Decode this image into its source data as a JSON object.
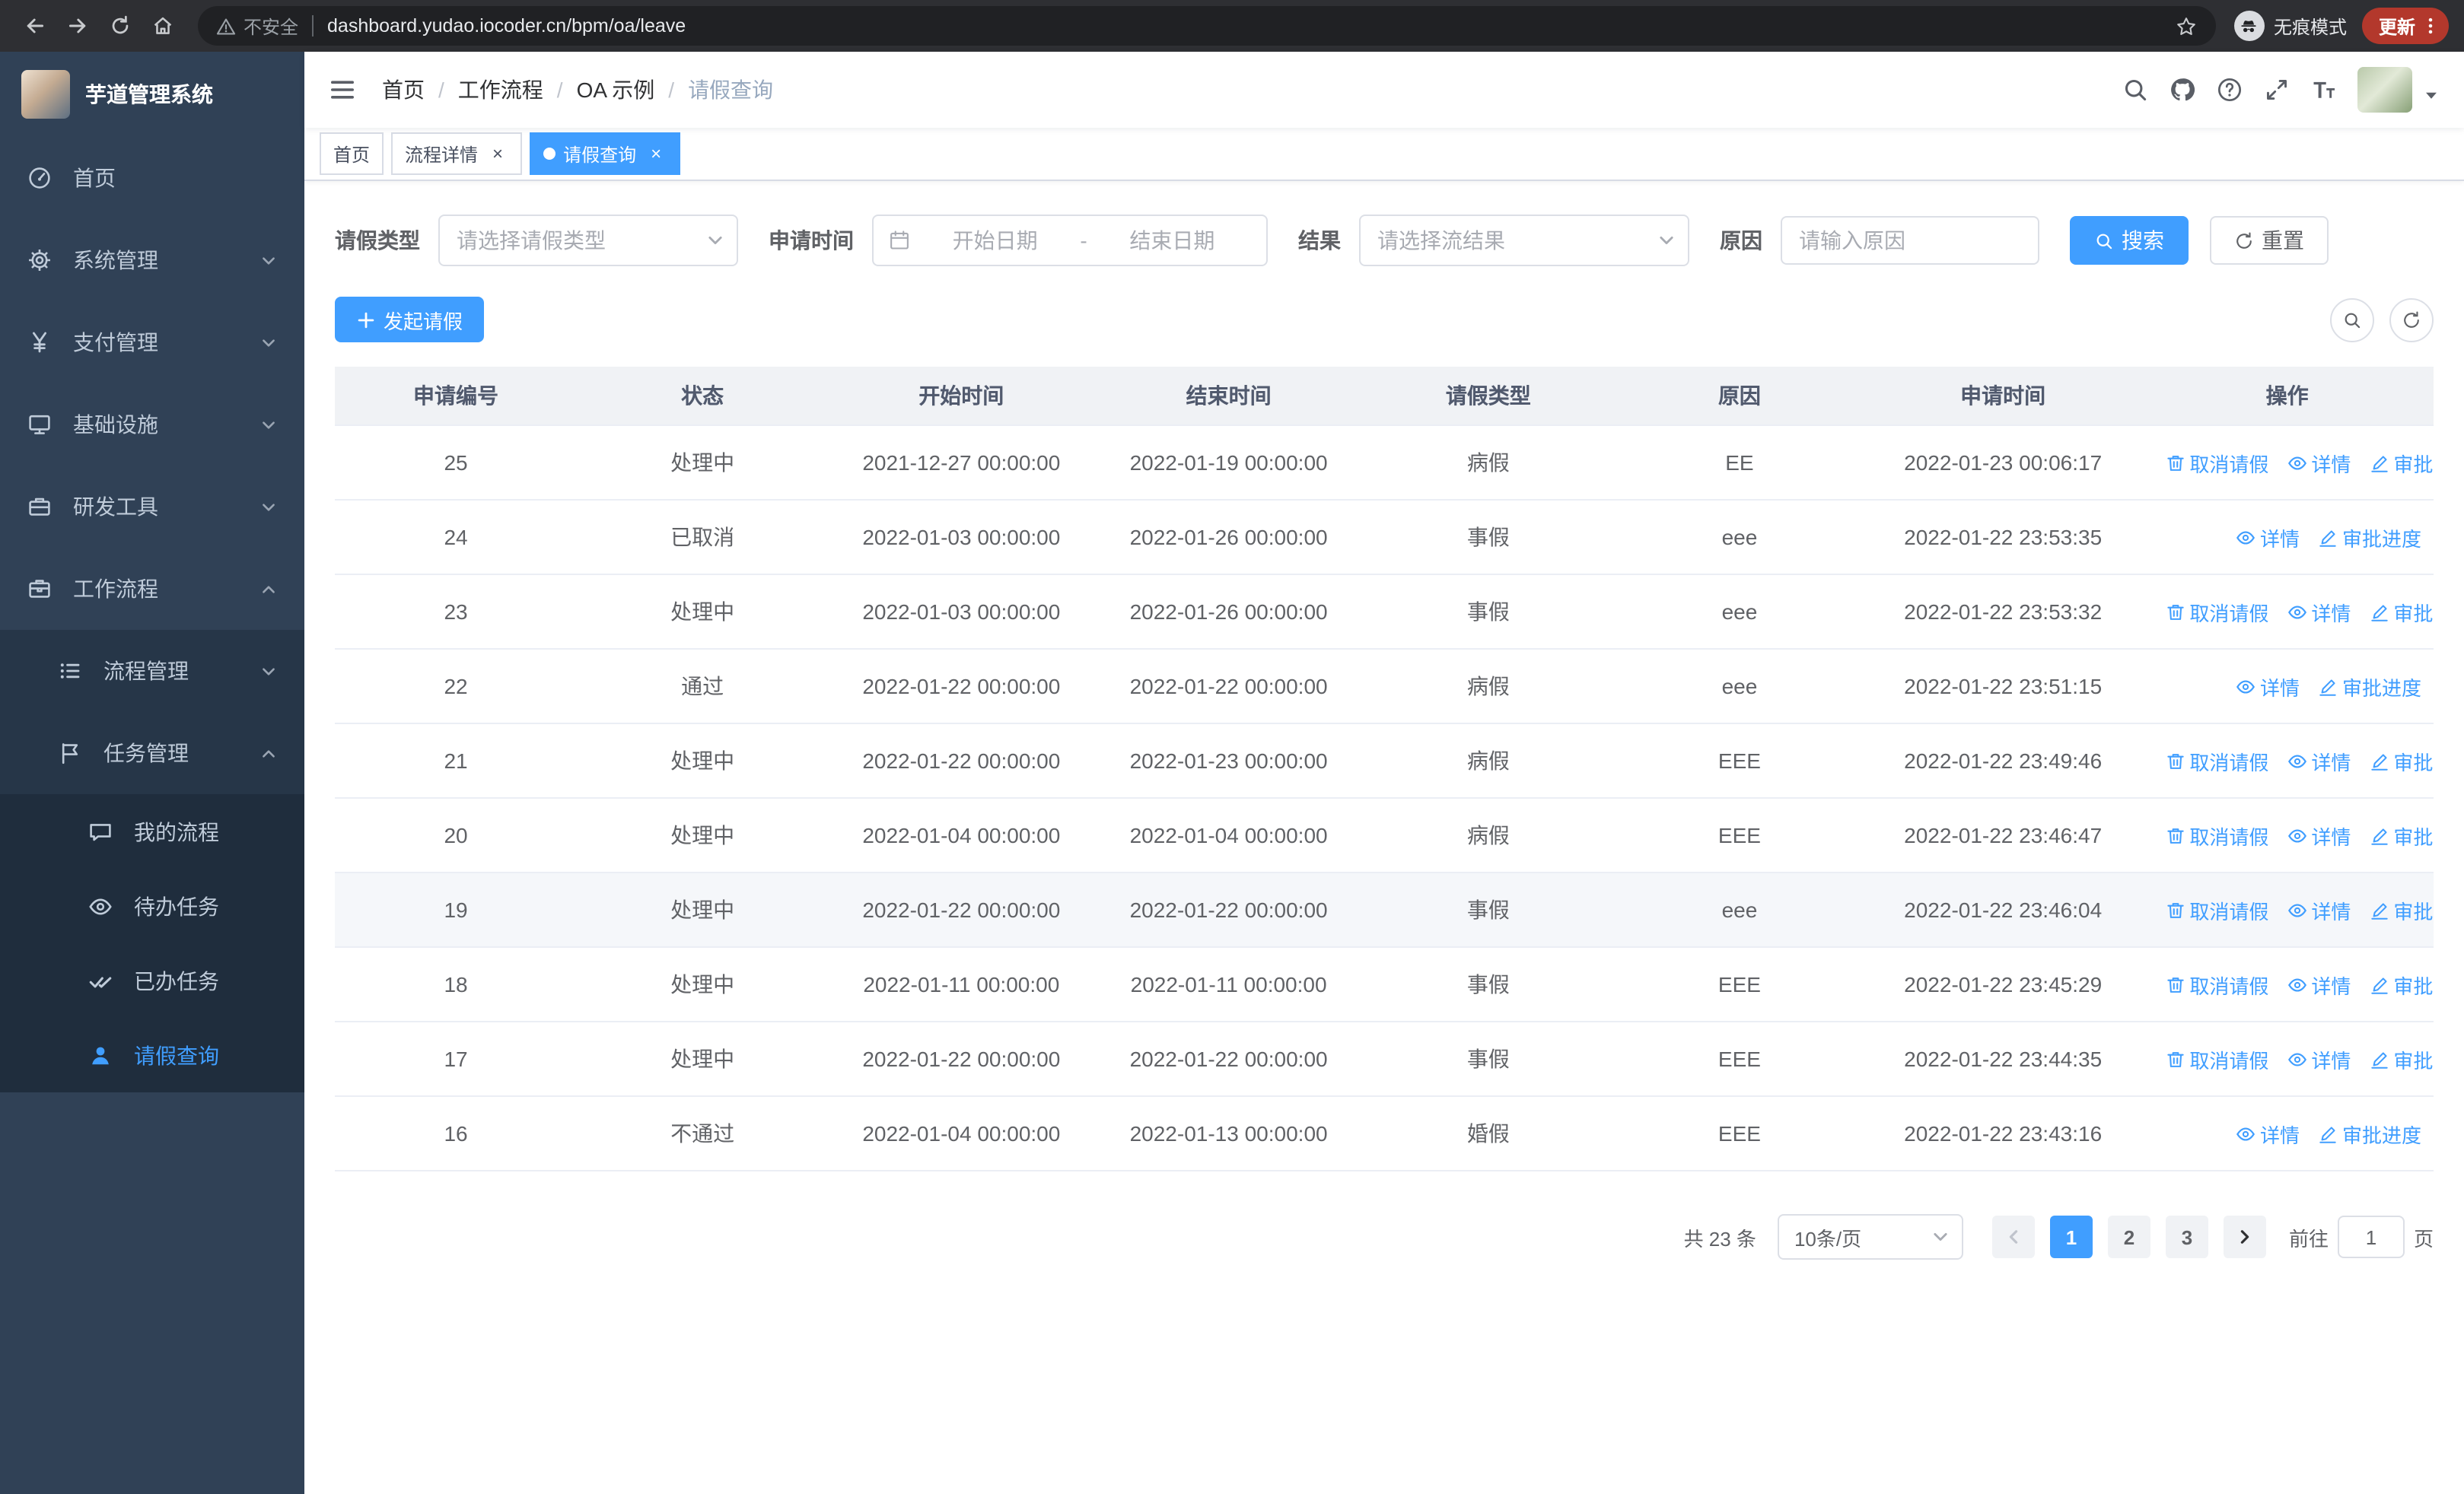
{
  "colors": {
    "accent": "#409eff"
  },
  "browser": {
    "security_chip": "不安全",
    "url": "dashboard.yudao.iocoder.cn/bpm/oa/leave",
    "incognito_label": "无痕模式",
    "update_button": "更新"
  },
  "sidebar": {
    "logo_title": "芋道管理系统",
    "menu": [
      {
        "id": "home",
        "label": "首页",
        "icon": "dashboard",
        "level": 1
      },
      {
        "id": "system",
        "label": "系统管理",
        "icon": "gear",
        "level": 1,
        "chevron": "down"
      },
      {
        "id": "payment",
        "label": "支付管理",
        "icon": "yen",
        "level": 1,
        "chevron": "down"
      },
      {
        "id": "infrastructure",
        "label": "基础设施",
        "icon": "monitor",
        "level": 1,
        "chevron": "down"
      },
      {
        "id": "dev-tools",
        "label": "研发工具",
        "icon": "toolbox",
        "level": 1,
        "chevron": "down"
      },
      {
        "id": "workflow",
        "label": "工作流程",
        "icon": "briefcase",
        "level": 1,
        "chevron": "up"
      },
      {
        "id": "process-management",
        "label": "流程管理",
        "icon": "list",
        "level": 2,
        "chevron": "down"
      },
      {
        "id": "task-management",
        "label": "任务管理",
        "icon": "flag",
        "level": 2,
        "chevron": "up"
      },
      {
        "id": "my-process",
        "label": "我的流程",
        "icon": "chat",
        "level": 3
      },
      {
        "id": "todo-tasks",
        "label": "待办任务",
        "icon": "eye",
        "level": 3
      },
      {
        "id": "done-tasks",
        "label": "已办任务",
        "icon": "dblcheck",
        "level": 3
      },
      {
        "id": "leave-query",
        "label": "请假查询",
        "icon": "user",
        "level": 3,
        "active": true
      }
    ]
  },
  "navbar": {
    "breadcrumb": [
      "首页",
      "工作流程",
      "OA 示例",
      "请假查询"
    ]
  },
  "tabs": [
    {
      "id": "home",
      "label": "首页",
      "active": false,
      "closable": false
    },
    {
      "id": "process-detail",
      "label": "流程详情",
      "active": false,
      "closable": true
    },
    {
      "id": "leave-query",
      "label": "请假查询",
      "active": true,
      "closable": true
    }
  ],
  "filters": {
    "leave_type_label": "请假类型",
    "leave_type_placeholder": "请选择请假类型",
    "apply_time_label": "申请时间",
    "start_date_placeholder": "开始日期",
    "date_separator": "-",
    "end_date_placeholder": "结束日期",
    "result_label": "结果",
    "result_placeholder": "请选择流结果",
    "reason_label": "原因",
    "reason_placeholder": "请输入原因",
    "search_button": "搜索",
    "reset_button": "重置"
  },
  "toolbar": {
    "create_button": "发起请假"
  },
  "table": {
    "columns": [
      {
        "key": "id",
        "label": "申请编号"
      },
      {
        "key": "status",
        "label": "状态"
      },
      {
        "key": "start",
        "label": "开始时间"
      },
      {
        "key": "end",
        "label": "结束时间"
      },
      {
        "key": "type",
        "label": "请假类型"
      },
      {
        "key": "reason",
        "label": "原因"
      },
      {
        "key": "apply_time",
        "label": "申请时间"
      },
      {
        "key": "actions",
        "label": "操作"
      }
    ],
    "action_labels": {
      "cancel": "取消请假",
      "detail": "详情",
      "progress": "审批进度"
    },
    "rows": [
      {
        "id": "25",
        "status": "处理中",
        "start": "2021-12-27 00:00:00",
        "end": "2022-01-19 00:00:00",
        "type": "病假",
        "reason": "EE",
        "apply_time": "2022-01-23 00:06:17",
        "can_cancel": true
      },
      {
        "id": "24",
        "status": "已取消",
        "start": "2022-01-03 00:00:00",
        "end": "2022-01-26 00:00:00",
        "type": "事假",
        "reason": "eee",
        "apply_time": "2022-01-22 23:53:35",
        "can_cancel": false
      },
      {
        "id": "23",
        "status": "处理中",
        "start": "2022-01-03 00:00:00",
        "end": "2022-01-26 00:00:00",
        "type": "事假",
        "reason": "eee",
        "apply_time": "2022-01-22 23:53:32",
        "can_cancel": true
      },
      {
        "id": "22",
        "status": "通过",
        "start": "2022-01-22 00:00:00",
        "end": "2022-01-22 00:00:00",
        "type": "病假",
        "reason": "eee",
        "apply_time": "2022-01-22 23:51:15",
        "can_cancel": false
      },
      {
        "id": "21",
        "status": "处理中",
        "start": "2022-01-22 00:00:00",
        "end": "2022-01-23 00:00:00",
        "type": "病假",
        "reason": "EEE",
        "apply_time": "2022-01-22 23:49:46",
        "can_cancel": true
      },
      {
        "id": "20",
        "status": "处理中",
        "start": "2022-01-04 00:00:00",
        "end": "2022-01-04 00:00:00",
        "type": "病假",
        "reason": "EEE",
        "apply_time": "2022-01-22 23:46:47",
        "can_cancel": true
      },
      {
        "id": "19",
        "status": "处理中",
        "start": "2022-01-22 00:00:00",
        "end": "2022-01-22 00:00:00",
        "type": "事假",
        "reason": "eee",
        "apply_time": "2022-01-22 23:46:04",
        "can_cancel": true,
        "highlight": true
      },
      {
        "id": "18",
        "status": "处理中",
        "start": "2022-01-11 00:00:00",
        "end": "2022-01-11 00:00:00",
        "type": "事假",
        "reason": "EEE",
        "apply_time": "2022-01-22 23:45:29",
        "can_cancel": true
      },
      {
        "id": "17",
        "status": "处理中",
        "start": "2022-01-22 00:00:00",
        "end": "2022-01-22 00:00:00",
        "type": "事假",
        "reason": "EEE",
        "apply_time": "2022-01-22 23:44:35",
        "can_cancel": true
      },
      {
        "id": "16",
        "status": "不通过",
        "start": "2022-01-04 00:00:00",
        "end": "2022-01-13 00:00:00",
        "type": "婚假",
        "reason": "EEE",
        "apply_time": "2022-01-22 23:43:16",
        "can_cancel": false
      }
    ]
  },
  "pagination": {
    "total": "共 23 条",
    "page_size": "10条/页",
    "pages": [
      "1",
      "2",
      "3"
    ],
    "current_page": "1",
    "goto_label": "前往",
    "goto_value": "1",
    "page_suffix": "页"
  }
}
